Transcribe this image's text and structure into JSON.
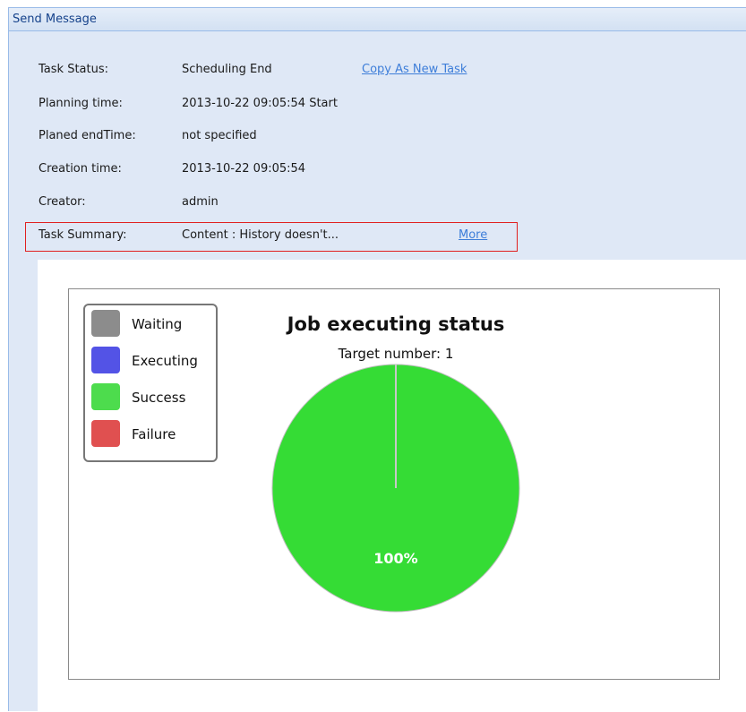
{
  "panel": {
    "title": "Send Message"
  },
  "info": {
    "task_status": {
      "label": "Task Status:",
      "value": "Scheduling End",
      "link": "Copy As New Task"
    },
    "planning_time": {
      "label": "Planning time:",
      "value": "2013-10-22 09:05:54 Start"
    },
    "planned_end": {
      "label": "Planed endTime:",
      "value": "not specified"
    },
    "creation_time": {
      "label": "Creation time:",
      "value": "2013-10-22 09:05:54"
    },
    "creator": {
      "label": "Creator:",
      "value": "admin"
    },
    "task_summary": {
      "label": "Task Summary:",
      "value": "Content : History doesn't...",
      "link": "More"
    }
  },
  "chart_data": {
    "type": "pie",
    "title": "Job executing status",
    "subtitle": "Target number: 1",
    "legend": [
      {
        "name": "Waiting",
        "color": "#8c8c8c"
      },
      {
        "name": "Executing",
        "color": "#5353e6"
      },
      {
        "name": "Success",
        "color": "#4ddc4d"
      },
      {
        "name": "Failure",
        "color": "#e05050"
      }
    ],
    "legend_placement": "top-left",
    "slices": [
      {
        "name": "Success",
        "value": 100,
        "label": "100%",
        "color": "#35dc35"
      }
    ]
  }
}
